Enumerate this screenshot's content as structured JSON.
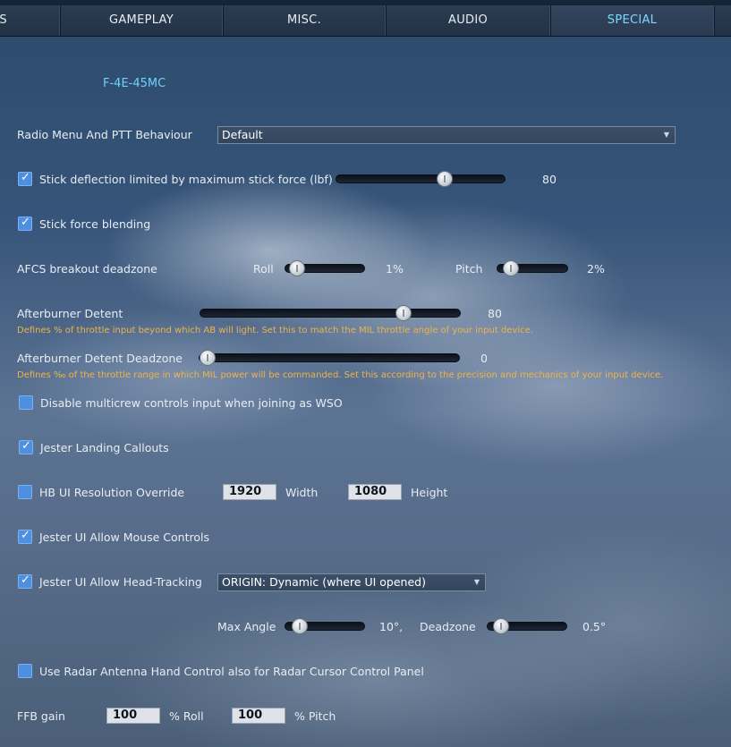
{
  "tabs": [
    {
      "label": "LS"
    },
    {
      "label": "GAMEPLAY"
    },
    {
      "label": "MISC."
    },
    {
      "label": "AUDIO"
    },
    {
      "label": "SPECIAL"
    }
  ],
  "module_title": "F-4E-45MC",
  "radio_menu": {
    "label": "Radio Menu And PTT Behaviour",
    "value": "Default"
  },
  "stick_deflection": {
    "label": "Stick deflection limited by maximum stick force (lbf)",
    "checked": true,
    "value": "80",
    "fraction": 0.66
  },
  "stick_force_blending": {
    "label": "Stick force blending",
    "checked": true
  },
  "afcs": {
    "label": "AFCS breakout deadzone",
    "roll_label": "Roll",
    "roll_value": "1%",
    "roll_fraction": 0.05,
    "pitch_label": "Pitch",
    "pitch_value": "2%",
    "pitch_fraction": 0.1
  },
  "afterburner_detent": {
    "label": "Afterburner Detent",
    "value": "80",
    "fraction": 0.8,
    "hint": "Defines % of throttle input beyond which AB will light. Set this to match the MIL throttle angle of your input device."
  },
  "afterburner_deadzone": {
    "label": "Afterburner Detent Deadzone",
    "value": "0",
    "fraction": 0.0,
    "hint": "Defines ‰ of the throttle range in which MIL power will be commanded. Set this according to the precision and mechanics of your input device."
  },
  "disable_multicrew": {
    "label": "Disable multicrew controls input when joining as WSO",
    "checked": false
  },
  "jester_landing": {
    "label": "Jester Landing Callouts",
    "checked": true
  },
  "hb_ui_resolution": {
    "label": "HB UI Resolution Override",
    "checked": false,
    "width_value": "1920",
    "width_label": "Width",
    "height_value": "1080",
    "height_label": "Height"
  },
  "jester_mouse": {
    "label": "Jester UI Allow Mouse Controls",
    "checked": true
  },
  "jester_headtracking": {
    "label": "Jester UI Allow Head-Tracking",
    "checked": true,
    "origin_value": "ORIGIN: Dynamic (where UI opened)"
  },
  "max_angle": {
    "label": "Max Angle",
    "value": "10°,",
    "fraction": 0.1,
    "deadzone_label": "Deadzone",
    "deadzone_value": "0.5°",
    "deadzone_fraction": 0.08
  },
  "radar_antenna": {
    "label": "Use Radar Antenna Hand Control also for Radar Cursor Control Panel",
    "checked": false
  },
  "ffb": {
    "label": "FFB gain",
    "roll_value": "100",
    "roll_label": "% Roll",
    "pitch_value": "100",
    "pitch_label": "% Pitch"
  },
  "colors": {
    "accent": "#6ed2ff",
    "hint": "#f0b24a",
    "checkbox": "#4f8fe0"
  }
}
